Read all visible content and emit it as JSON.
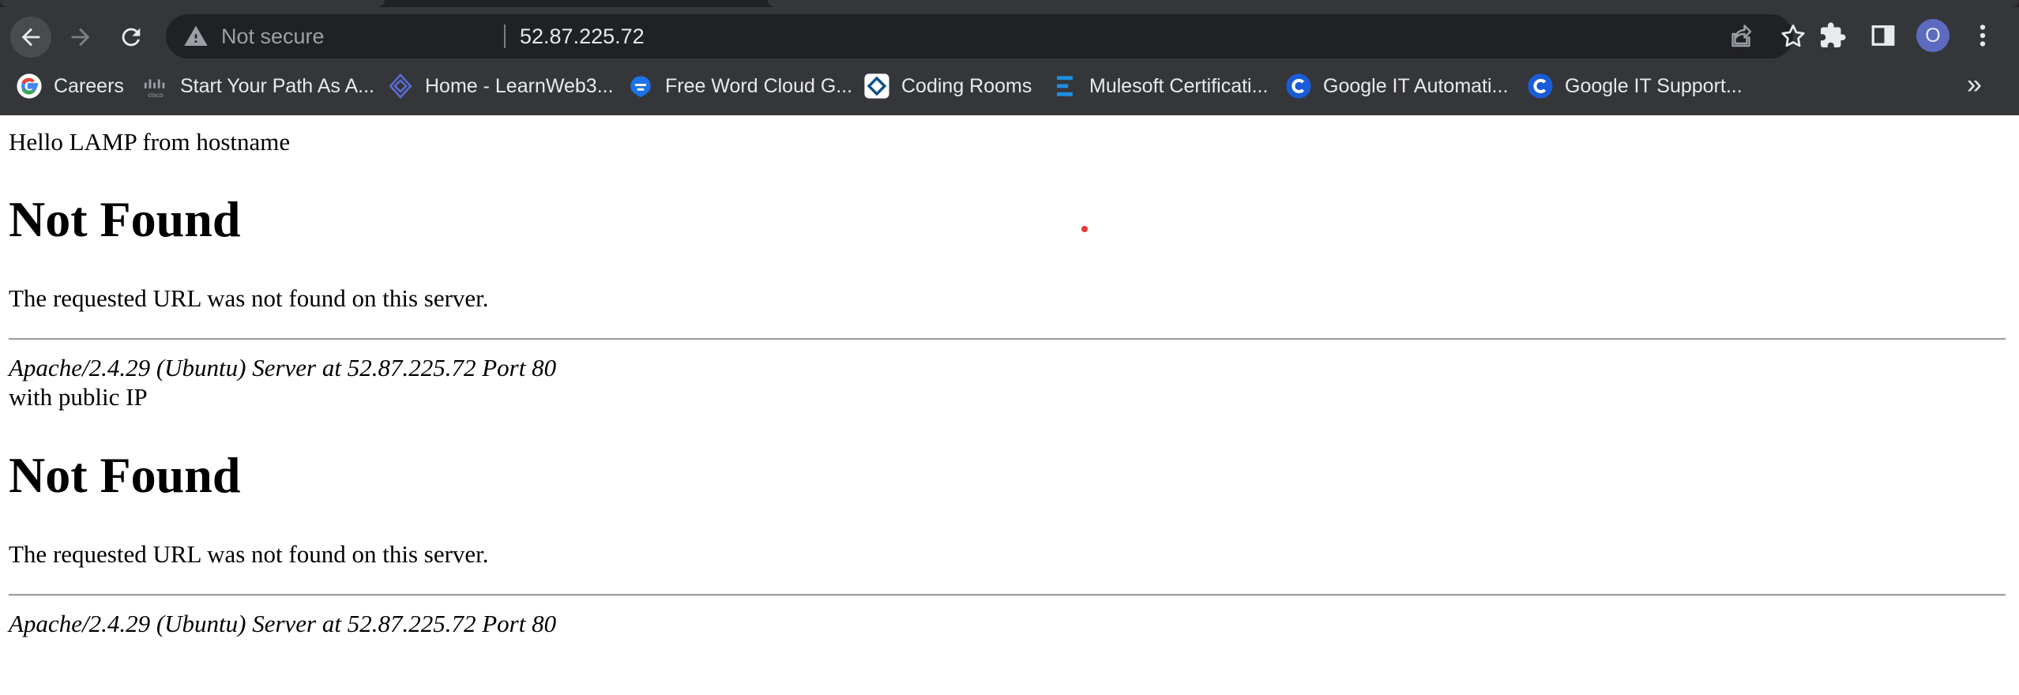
{
  "browser": {
    "omnibox": {
      "security_label": "Not secure",
      "url": "52.87.225.72"
    },
    "profile_initial": "O",
    "bookmarks": [
      {
        "label": "Careers",
        "icon": "google-g-icon"
      },
      {
        "label": "Start Your Path As A...",
        "icon": "cisco-icon"
      },
      {
        "label": "Home - LearnWeb3...",
        "icon": "learnweb3-icon"
      },
      {
        "label": "Free Word Cloud G...",
        "icon": "wordcloud-icon"
      },
      {
        "label": "Coding Rooms",
        "icon": "coding-rooms-icon"
      },
      {
        "label": "Mulesoft Certificati...",
        "icon": "mulesoft-icon"
      },
      {
        "label": "Google IT Automati...",
        "icon": "coursera-icon"
      },
      {
        "label": "Google IT Support...",
        "icon": "coursera-icon"
      }
    ],
    "bookmarks_overflow": "»",
    "colors": {
      "chrome_bg": "#35363a",
      "omnibox_bg": "#202124",
      "avatar": "#5c6bc0"
    }
  },
  "page": {
    "greeting": "Hello LAMP from hostname",
    "block1": {
      "title": "Not Found",
      "message": "The requested URL was not found on this server.",
      "address": "Apache/2.4.29 (Ubuntu) Server at 52.87.225.72 Port 80"
    },
    "public_ip_text": "with public IP",
    "block2": {
      "title": "Not Found",
      "message": "The requested URL was not found on this server.",
      "address": "Apache/2.4.29 (Ubuntu) Server at 52.87.225.72 Port 80"
    }
  }
}
